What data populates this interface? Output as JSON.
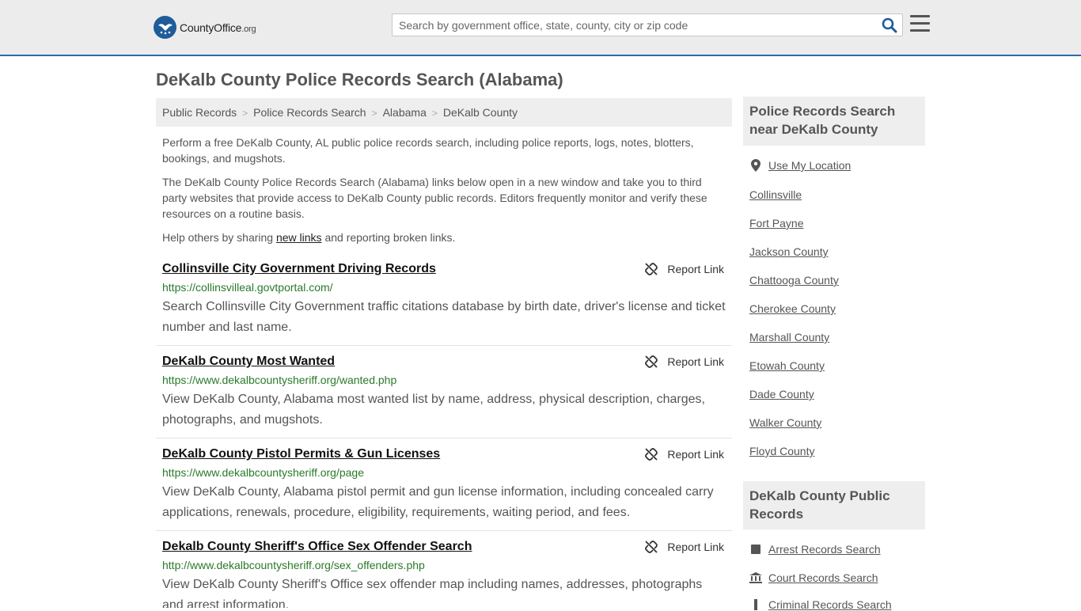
{
  "header": {
    "logo_text": "CountyOffice",
    "logo_suffix": ".org",
    "search_placeholder": "Search by government office, state, county, city or zip code"
  },
  "page_title": "DeKalb County Police Records Search (Alabama)",
  "breadcrumb": [
    "Public Records",
    "Police Records Search",
    "Alabama",
    "DeKalb County"
  ],
  "intro": {
    "p1": "Perform a free DeKalb County, AL public police records search, including police reports, logs, notes, blotters, bookings, and mugshots.",
    "p2": "The DeKalb County Police Records Search (Alabama) links below open in a new window and take you to third party websites that provide access to DeKalb County public records. Editors frequently monitor and verify these resources on a routine basis.",
    "p3_before": "Help others by sharing ",
    "p3_link": "new links",
    "p3_after": " and reporting broken links."
  },
  "report_label": "Report Link",
  "results": [
    {
      "title": "Collinsville City Government Driving Records",
      "url": "https://collinsvilleal.govtportal.com/",
      "desc": "Search Collinsville City Government traffic citations database by birth date, driver's license and ticket number and last name."
    },
    {
      "title": "DeKalb County Most Wanted",
      "url": "https://www.dekalbcountysheriff.org/wanted.php",
      "desc": "View DeKalb County, Alabama most wanted list by name, address, physical description, charges, photographs, and mugshots."
    },
    {
      "title": "DeKalb County Pistol Permits & Gun Licenses",
      "url": "https://www.dekalbcountysheriff.org/page",
      "desc": "View DeKalb County, Alabama pistol permit and gun license information, including concealed carry applications, renewals, procedure, eligibility, requirements, waiting period, and fees."
    },
    {
      "title": "Dekalb County Sheriff's Office Sex Offender Search",
      "url": "http://www.dekalbcountysheriff.org/sex_offenders.php",
      "desc": "View DeKalb County Sheriff's Office sex offender map including names, addresses, photographs and arrest information."
    }
  ],
  "sidebar": {
    "nearby_title": "Police Records Search near DeKalb County",
    "use_location": "Use My Location",
    "nearby": [
      "Collinsville",
      "Fort Payne",
      "Jackson County",
      "Chattooga County",
      "Cherokee County",
      "Marshall County",
      "Etowah County",
      "Dade County",
      "Walker County",
      "Floyd County"
    ],
    "public_title": "DeKalb County Public Records",
    "public_links": [
      "Arrest Records Search",
      "Court Records Search",
      "Criminal Records Search"
    ]
  }
}
